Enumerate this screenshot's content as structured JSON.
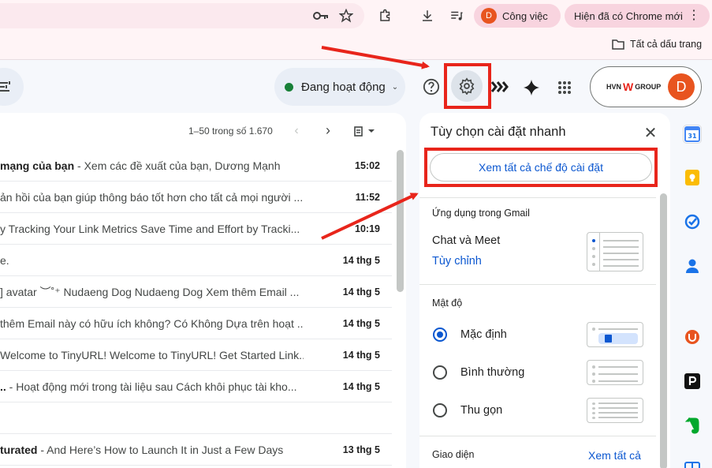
{
  "browser": {
    "profile_label": "Công việc",
    "profile_initial": "D",
    "new_chrome_label": "Hiện đã có Chrome mới",
    "all_bookmarks_label": "Tất cả dấu trang"
  },
  "header": {
    "status_label": "Đang hoạt động",
    "account_logo": "HVN GROUP",
    "account_logo_left": "HVN",
    "account_logo_right": "GROUP",
    "account_initial": "D"
  },
  "mail": {
    "pager": "1–50 trong số 1.670",
    "rows": [
      {
        "bold": "mạng của bạn",
        "snippet": " - Xem các đề xuất của bạn, Dương Mạnh",
        "time": "15:02"
      },
      {
        "bold": "",
        "snippet": "ản hồi của bạn giúp thông báo tốt hơn cho tất cả mọi người ...",
        "time": "11:52"
      },
      {
        "bold": "",
        "snippet": "y Tracking Your Link Metrics Save Time and Effort by Tracki...",
        "time": "10:19"
      },
      {
        "bold": "",
        "snippet": "e.",
        "time": "14 thg 5"
      },
      {
        "bold": "",
        "snippet": "] avatar ︶˚⁺ Nudaeng Dog Nudaeng Dog Xem thêm Email ...",
        "time": "14 thg 5"
      },
      {
        "bold": "",
        "snippet": "thêm Email này có hữu ích không? Có Không Dựa trên hoạt ...",
        "time": "14 thg 5"
      },
      {
        "bold": "",
        "snippet": "Welcome to TinyURL! Welcome to TinyURL! Get Started Link...",
        "time": "14 thg 5"
      },
      {
        "bold": "..",
        "snippet": " - Hoạt động mới trong tài liệu sau Cách khôi phục tài kho...",
        "time": "14 thg 5"
      },
      {
        "bold": "",
        "snippet": "",
        "time": ""
      },
      {
        "bold": "turated",
        "snippet": " - And Here’s How to Launch It in Just a Few Days",
        "time": "13 thg 5"
      }
    ]
  },
  "quick_settings": {
    "title": "Tùy chọn cài đặt nhanh",
    "see_all_button": "Xem tất cả chế độ cài đặt",
    "apps_section": "Ứng dụng trong Gmail",
    "chat_meet": "Chat và Meet",
    "customize": "Tùy chỉnh",
    "density_section": "Mật độ",
    "density_options": [
      {
        "label": "Mặc định",
        "selected": true
      },
      {
        "label": "Bình thường",
        "selected": false
      },
      {
        "label": "Thu gọn",
        "selected": false
      }
    ],
    "theme_section": "Giao diện",
    "see_all_link": "Xem tất cả"
  },
  "colors": {
    "accent_blue": "#0b57d0",
    "annotation_red": "#e8251b",
    "status_green": "#188038",
    "avatar_orange": "#e8541f"
  }
}
